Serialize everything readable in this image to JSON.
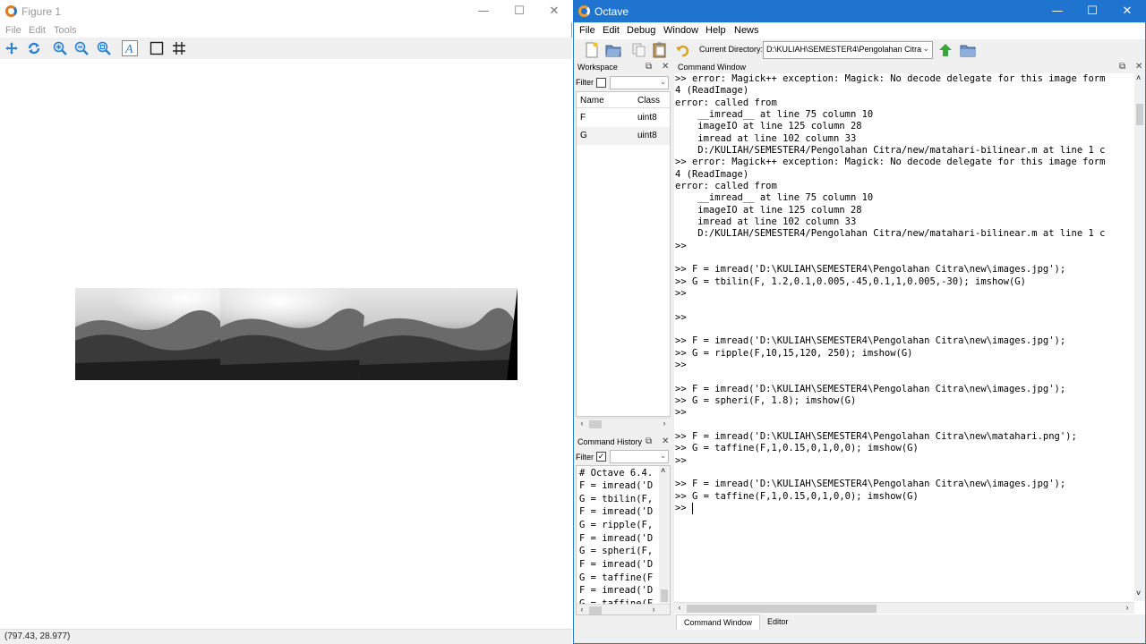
{
  "figure_window": {
    "title": "Figure 1",
    "menu": [
      "File",
      "Edit",
      "Tools"
    ],
    "toolbar_icons": [
      "pan-icon",
      "rotate-icon",
      "zoom-in-icon",
      "zoom-out-icon",
      "zoom-auto-icon",
      "text-icon",
      "axes-box-icon",
      "grid-icon"
    ],
    "status_coords": "(797.43, 28.977)"
  },
  "octave_window": {
    "title": "Octave",
    "menu": [
      "File",
      "Edit",
      "Debug",
      "Window",
      "Help",
      "News"
    ],
    "current_directory_label": "Current Directory:",
    "current_directory": "D:\\KULIAH\\SEMESTER4\\Pengolahan Citra"
  },
  "workspace": {
    "title": "Workspace",
    "filter_label": "Filter",
    "columns": [
      "Name",
      "Class"
    ],
    "rows": [
      {
        "name": "F",
        "class": "uint8"
      },
      {
        "name": "G",
        "class": "uint8"
      }
    ]
  },
  "command_history": {
    "title": "Command History",
    "filter_label": "Filter",
    "entries": [
      "# Octave 6.4.",
      "F = imread('D",
      "G = tbilin(F,",
      "F = imread('D",
      "G = ripple(F,",
      "F = imread('D",
      "G = spheri(F,",
      "F = imread('D",
      "G = taffine(F",
      "F = imread('D",
      "G = taffine(F"
    ]
  },
  "command_window": {
    "title": "Command Window",
    "lines": [
      ">> error: Magick++ exception: Magick: No decode delegate for this image form",
      "4 (ReadImage)",
      "error: called from",
      "    __imread__ at line 75 column 10",
      "    imageIO at line 125 column 28",
      "    imread at line 102 column 33",
      "    D:/KULIAH/SEMESTER4/Pengolahan Citra/new/matahari-bilinear.m at line 1 c",
      ">> error: Magick++ exception: Magick: No decode delegate for this image form",
      "4 (ReadImage)",
      "error: called from",
      "    __imread__ at line 75 column 10",
      "    imageIO at line 125 column 28",
      "    imread at line 102 column 33",
      "    D:/KULIAH/SEMESTER4/Pengolahan Citra/new/matahari-bilinear.m at line 1 c",
      ">>",
      "",
      ">> F = imread('D:\\KULIAH\\SEMESTER4\\Pengolahan Citra\\new\\images.jpg');",
      ">> G = tbilin(F, 1.2,0.1,0.005,-45,0.1,1,0.005,-30); imshow(G)",
      ">>",
      "",
      ">>",
      "",
      "",
      ">> F = imread('D:\\KULIAH\\SEMESTER4\\Pengolahan Citra\\new\\images.jpg');",
      ">> G = ripple(F,10,15,120, 250); imshow(G)",
      ">>",
      "",
      ">> F = imread('D:\\KULIAH\\SEMESTER4\\Pengolahan Citra\\new\\images.jpg');",
      ">> G = spheri(F, 1.8); imshow(G)",
      ">>",
      "",
      ">> F = imread('D:\\KULIAH\\SEMESTER4\\Pengolahan Citra\\new\\matahari.png');",
      ">> G = taffine(F,1,0.15,0,1,0,0); imshow(G)",
      ">>",
      "",
      ">> F = imread('D:\\KULIAH\\SEMESTER4\\Pengolahan Citra\\new\\images.jpg');",
      ">> G = taffine(F,1,0.15,0,1,0,0); imshow(G)",
      ">> "
    ]
  },
  "tabs": [
    "Command Window",
    "Editor"
  ],
  "colors": {
    "octave_titlebar": "#1f74cf",
    "panel_bg": "#f0f0f0",
    "toolbar_green_arrow": "#3aa53a"
  }
}
